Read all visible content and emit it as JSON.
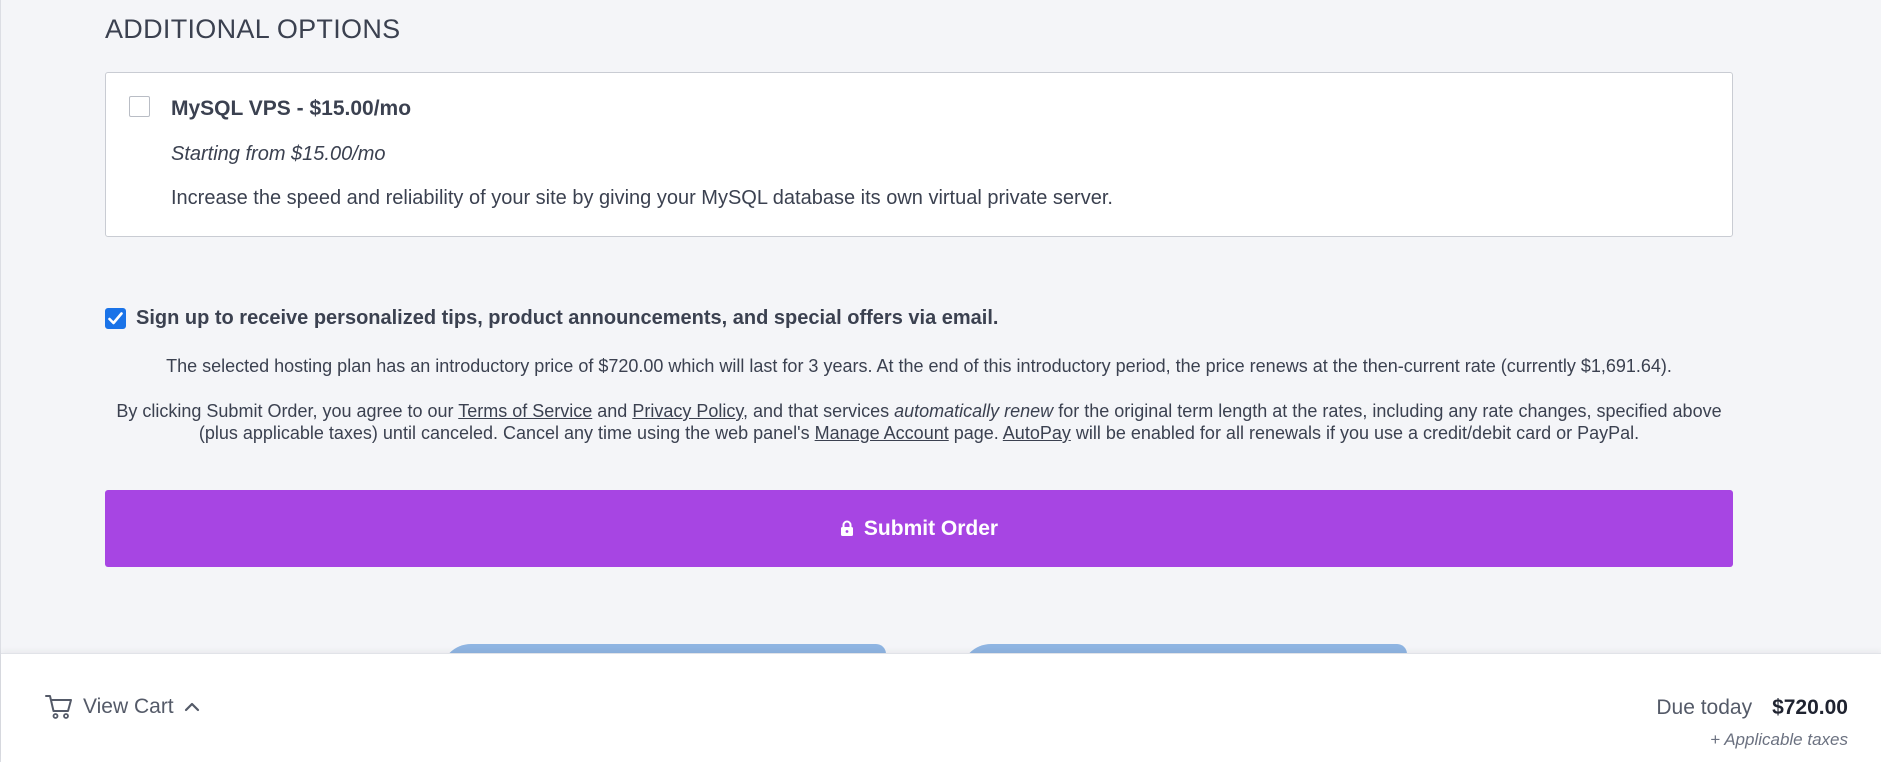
{
  "section_title": "ADDITIONAL OPTIONS",
  "addon": {
    "name": "MySQL VPS - $15.00/mo",
    "starting_from": "Starting from $15.00/mo",
    "description": "Increase the speed and reliability of your site by giving your MySQL database its own virtual private server.",
    "checked": false
  },
  "newsletter": {
    "label": "Sign up to receive personalized tips, product announcements, and special offers via email.",
    "checked": true
  },
  "intro_price_text": "The selected hosting plan has an introductory price of $720.00 which will last for 3 years. At the end of this introductory period, the price renews at the then-current rate (currently $1,691.64).",
  "terms": {
    "part1": "By clicking Submit Order, you agree to our ",
    "tos_link": "Terms of Service",
    "part2": " and ",
    "privacy_link": "Privacy Policy",
    "part3": ", and that services ",
    "auto_renew": "automatically renew",
    "part4": " for the original term length at the rates, including any rate changes, specified above (plus applicable taxes) until canceled. Cancel any time using the web panel's ",
    "manage_link": "Manage Account",
    "part5": " page. ",
    "autopay_link": "AutoPay",
    "part6": " will be enabled for all renewals if you use a credit/debit card or PayPal."
  },
  "submit_label": "Submit Order",
  "cart": {
    "view_label": "View Cart",
    "due_label": "Due today",
    "due_amount": "$720.00",
    "taxes_note": "+ Applicable taxes"
  },
  "colors": {
    "submit": "#a745e3",
    "checkbox": "#1a73e8",
    "background": "#f4f5f8"
  },
  "icons": [
    "lock-icon",
    "cart-icon",
    "chevron-up-icon",
    "checkmark-icon"
  ]
}
